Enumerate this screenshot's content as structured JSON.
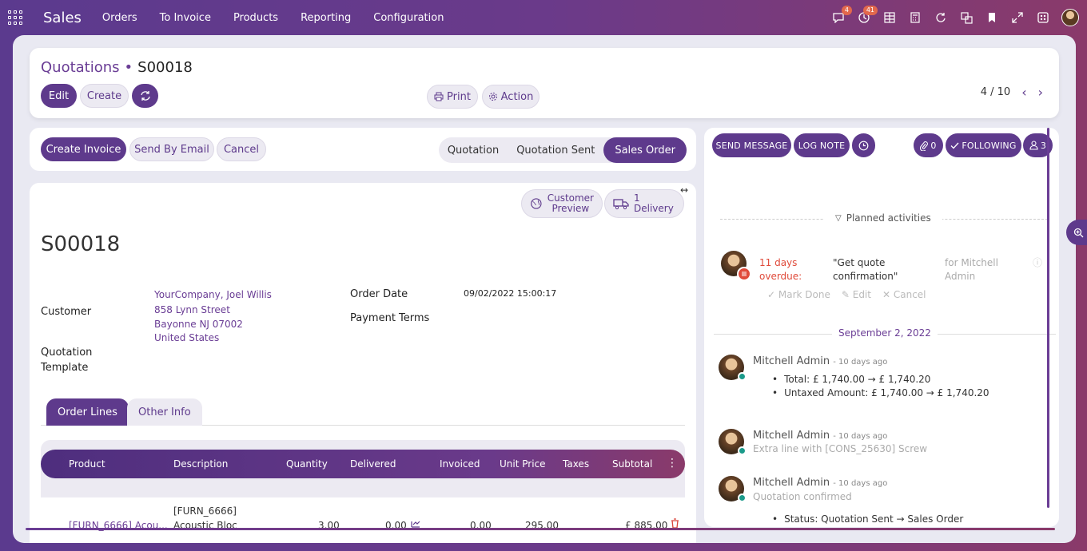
{
  "topbar": {
    "brand": "Sales",
    "menu": [
      "Orders",
      "To Invoice",
      "Products",
      "Reporting",
      "Configuration"
    ],
    "badges": {
      "messages": "4",
      "activities": "41"
    }
  },
  "breadcrumb": {
    "parent": "Quotations",
    "separator": "•",
    "current": "S00018"
  },
  "control": {
    "edit": "Edit",
    "create": "Create",
    "print": "Print",
    "action": "Action",
    "pager": "4 / 10"
  },
  "header_buttons": {
    "create_invoice": "Create Invoice",
    "send_by_email": "Send By Email",
    "cancel": "Cancel"
  },
  "statusbar": [
    "Quotation",
    "Quotation Sent",
    "Sales Order"
  ],
  "smart_buttons": {
    "preview_line1": "Customer",
    "preview_line2": "Preview",
    "delivery_line1": "1",
    "delivery_line2": "Delivery"
  },
  "record": {
    "name": "S00018",
    "customer_label": "Customer",
    "customer_lines": [
      "YourCompany, Joel Willis",
      "858 Lynn Street",
      "Bayonne NJ 07002",
      "United States"
    ],
    "template_label_1": "Quotation",
    "template_label_2": "Template",
    "order_date_label": "Order Date",
    "order_date": "09/02/2022 15:00:17",
    "payment_terms_label": "Payment Terms"
  },
  "tabs": [
    "Order Lines",
    "Other Info"
  ],
  "lines_table": {
    "headers": [
      "Product",
      "Description",
      "Quantity",
      "Delivered",
      "Invoiced",
      "Unit Price",
      "Taxes",
      "Subtotal"
    ],
    "row": {
      "product": "[FURN_6666] Acou...",
      "desc_1": "[FURN_6666]",
      "desc_2": "Acoustic Bloc",
      "quantity": "3.00",
      "delivered": "0.00",
      "invoiced": "0.00",
      "unit_price": "295.00",
      "subtotal": "£ 885.00"
    }
  },
  "chatter": {
    "send_message": "SEND MESSAGE",
    "log_note": "LOG NOTE",
    "attachments": "0",
    "following": "FOLLOWING",
    "followers": "3",
    "planned": "Planned activities",
    "activity": {
      "overdue_1": "11 days",
      "overdue_2": "overdue:",
      "summary_1": "\"Get quote",
      "summary_2": "confirmation\"",
      "for_1": "for Mitchell",
      "for_2": "Admin",
      "mark_done": "Mark Done",
      "edit": "Edit",
      "cancel": "Cancel"
    },
    "date_separator": "September 2, 2022",
    "messages": [
      {
        "author": "Mitchell Admin",
        "ago": "- 10 days ago",
        "changes": [
          "Total: £ 1,740.00 → £ 1,740.20",
          "Untaxed Amount: £ 1,740.00 → £ 1,740.20"
        ]
      },
      {
        "author": "Mitchell Admin",
        "ago": "- 10 days ago",
        "body": "Extra line with [CONS_25630] Screw"
      },
      {
        "author": "Mitchell Admin",
        "ago": "- 10 days ago",
        "body": "Quotation confirmed",
        "changes": [
          "Status: Quotation Sent → Sales Order"
        ]
      }
    ]
  },
  "colors": {
    "primary": "#5e3a8c",
    "overdue": "#e04a3a",
    "online": "#1a9a8a"
  }
}
